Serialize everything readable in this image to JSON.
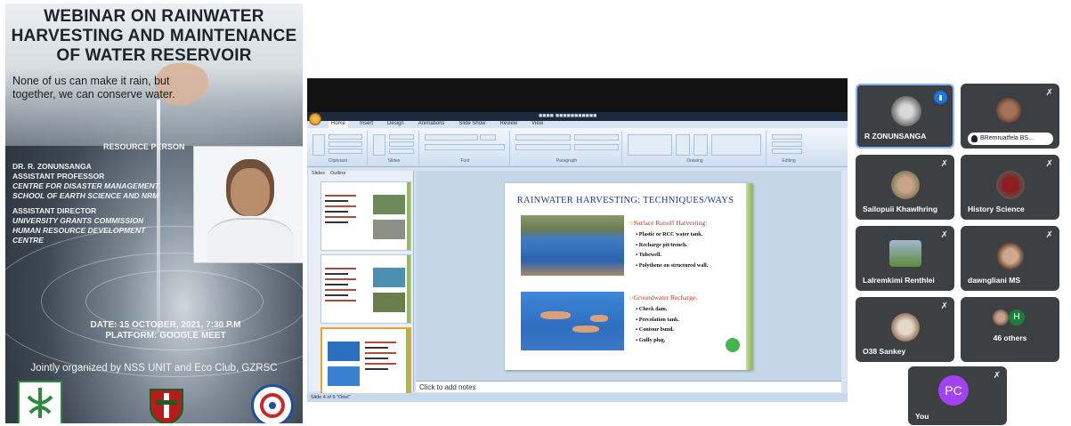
{
  "poster": {
    "title": "WEBINAR ON RAINWATER HARVESTING AND MAINTENANCE OF WATER RESERVOIR",
    "quote": "None of us can make it rain, but together, we can conserve water.",
    "resource_person_label": "RESOURCE PERSON",
    "person_name": "DR. R. ZONUNSANGA",
    "person_role1": "ASSISTANT PROFESSOR",
    "person_dept1": "CENTRE FOR DISASTER MANAGEMENT",
    "person_dept2": "SCHOOL OF EARTH SCIENCE AND NRM",
    "person_role2": "ASSISTANT DIRECTOR",
    "person_org1": "UNIVERSITY GRANTS COMMISSION",
    "person_org2": "HUMAN RESOURCE DEVELOPMENT",
    "person_org3": "CENTRE",
    "date": "DATE: 15 OCTOBER, 2021, 7:30 P.M",
    "platform": "PLATFORM: GOOGLE MEET",
    "organizers": "Jointly organized by NSS UNIT and Eco Club, GZRSC"
  },
  "presentation": {
    "tabs": [
      "Home",
      "Insert",
      "Design",
      "Animations",
      "Slide Show",
      "Review",
      "View"
    ],
    "ribbon_groups": [
      "Clipboard",
      "Slides",
      "Font",
      "Paragraph",
      "Drawing",
      "Editing"
    ],
    "panel_tabs": [
      "Slides",
      "Outline"
    ],
    "slide_title": "RAINWATER HARVESTING: TECHNIQUES/WAYS",
    "section1_heading": "Surface Runoff Harvesting:",
    "section1_items": [
      "Plastic or RCC water tank.",
      "Recharge pit/trench.",
      "Tubewell.",
      "Polythene on structured wall."
    ],
    "section2_heading": "Groundwater Recharge:",
    "section2_items": [
      "Check dam.",
      "Percolation tank.",
      "Contour bund.",
      "Gully plug."
    ],
    "notes_placeholder": "Click to add notes",
    "status": "Slide 4 of 9   \"Oriel\""
  },
  "participants": {
    "tiles": [
      {
        "name": "R ZONUNSANGA"
      },
      {
        "name": "BRemruatfela BS..."
      },
      {
        "name": "Sailopuii Khawlhring"
      },
      {
        "name": "History Science"
      },
      {
        "name": "Lalremkimi Renthlei"
      },
      {
        "name": "dawngliani MS"
      },
      {
        "name": "O38 Sankey"
      },
      {
        "name": "46 others"
      },
      {
        "name": "You",
        "initials": "PC"
      }
    ],
    "others_initial": "H"
  },
  "icons": {
    "mic_off": "mic-off-icon",
    "audio_active": "audio-level-icon"
  },
  "colors": {
    "meet_tile": "#3c4043",
    "avatar_you": "#a142f4",
    "avatar_others": "#188038",
    "active_speaker": "#1a73e8"
  }
}
